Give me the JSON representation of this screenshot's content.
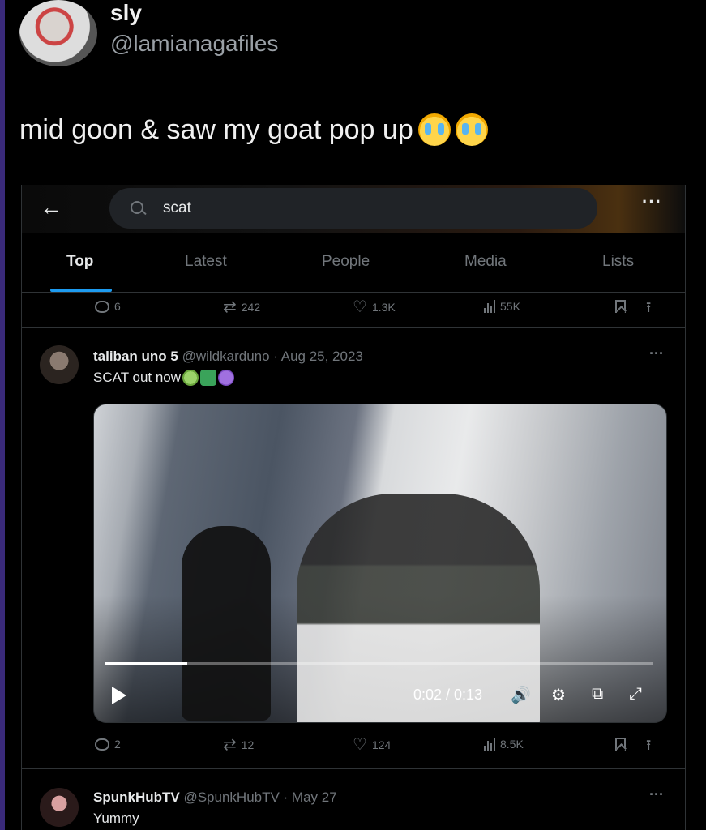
{
  "outer": {
    "name": "sly",
    "handle": "@lamianagafiles",
    "text": "mid goon & saw my goat pop up",
    "emojis": [
      "loudly-crying-face",
      "loudly-crying-face"
    ]
  },
  "embed": {
    "search": {
      "query": "scat"
    },
    "tabs": [
      {
        "label": "Top",
        "active": true
      },
      {
        "label": "Latest",
        "active": false
      },
      {
        "label": "People",
        "active": false
      },
      {
        "label": "Media",
        "active": false
      },
      {
        "label": "Lists",
        "active": false
      }
    ],
    "prev_tweet_actions": {
      "replies": "6",
      "reposts": "242",
      "likes": "1.3K",
      "views": "55K"
    },
    "tweet1": {
      "name": "taliban uno 5",
      "meta": "@wildkarduno · Aug 25, 2023",
      "text": "SCAT out now",
      "emojis": [
        "nauseated-face",
        "swirl",
        "smiling-face-with-horns"
      ],
      "video": {
        "time": "0:02 / 0:13",
        "progress": 0.15
      },
      "actions": {
        "replies": "2",
        "reposts": "12",
        "likes": "124",
        "views": "8.5K"
      }
    },
    "tweet2": {
      "name": "SpunkHubTV",
      "meta": "@SpunkHubTV · May 27",
      "text": "Yummy"
    }
  },
  "colors": {
    "accent": "#1d9bf0",
    "muted": "#71767b",
    "background": "#000000"
  }
}
